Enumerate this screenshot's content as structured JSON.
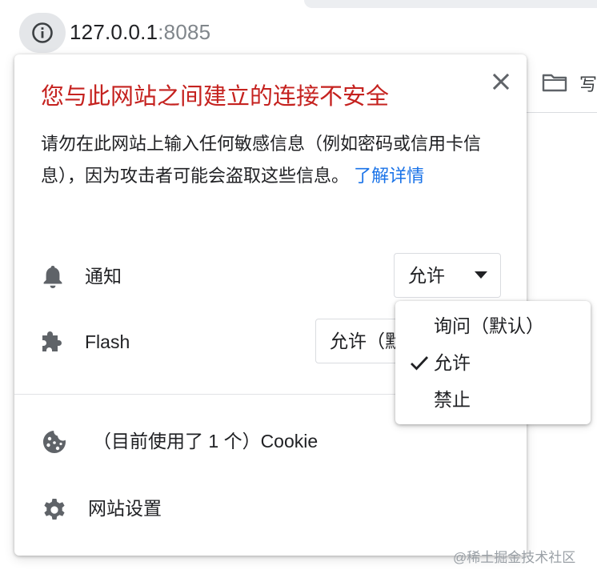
{
  "address_bar": {
    "host": "127.0.0.1",
    "port": ":8085"
  },
  "bookmarks": {
    "visible_label": "写"
  },
  "site_info_popup": {
    "title": "您与此网站之间建立的连接不安全",
    "description": "请勿在此网站上输入任何敏感信息（例如密码或信用卡信息），因为攻击者可能会盗取这些信息。",
    "learn_more": "了解详情",
    "permissions": [
      {
        "icon": "bell-icon",
        "label": "通知",
        "value": "允许"
      },
      {
        "icon": "puzzle-icon",
        "label": "Flash",
        "value": "允许（默认）"
      }
    ],
    "cookies": {
      "icon": "cookie-icon",
      "label": "（目前使用了 1 个）Cookie"
    },
    "site_settings": {
      "icon": "gear-icon",
      "label": "网站设置"
    }
  },
  "dropdown": {
    "options": [
      "询问（默认）",
      "允许",
      "禁止"
    ],
    "selected": "允许"
  },
  "watermark": "@稀土掘金技术社区",
  "colors": {
    "warning_title": "#c5221f",
    "link": "#1a73e8",
    "icon": "#5f6368"
  }
}
